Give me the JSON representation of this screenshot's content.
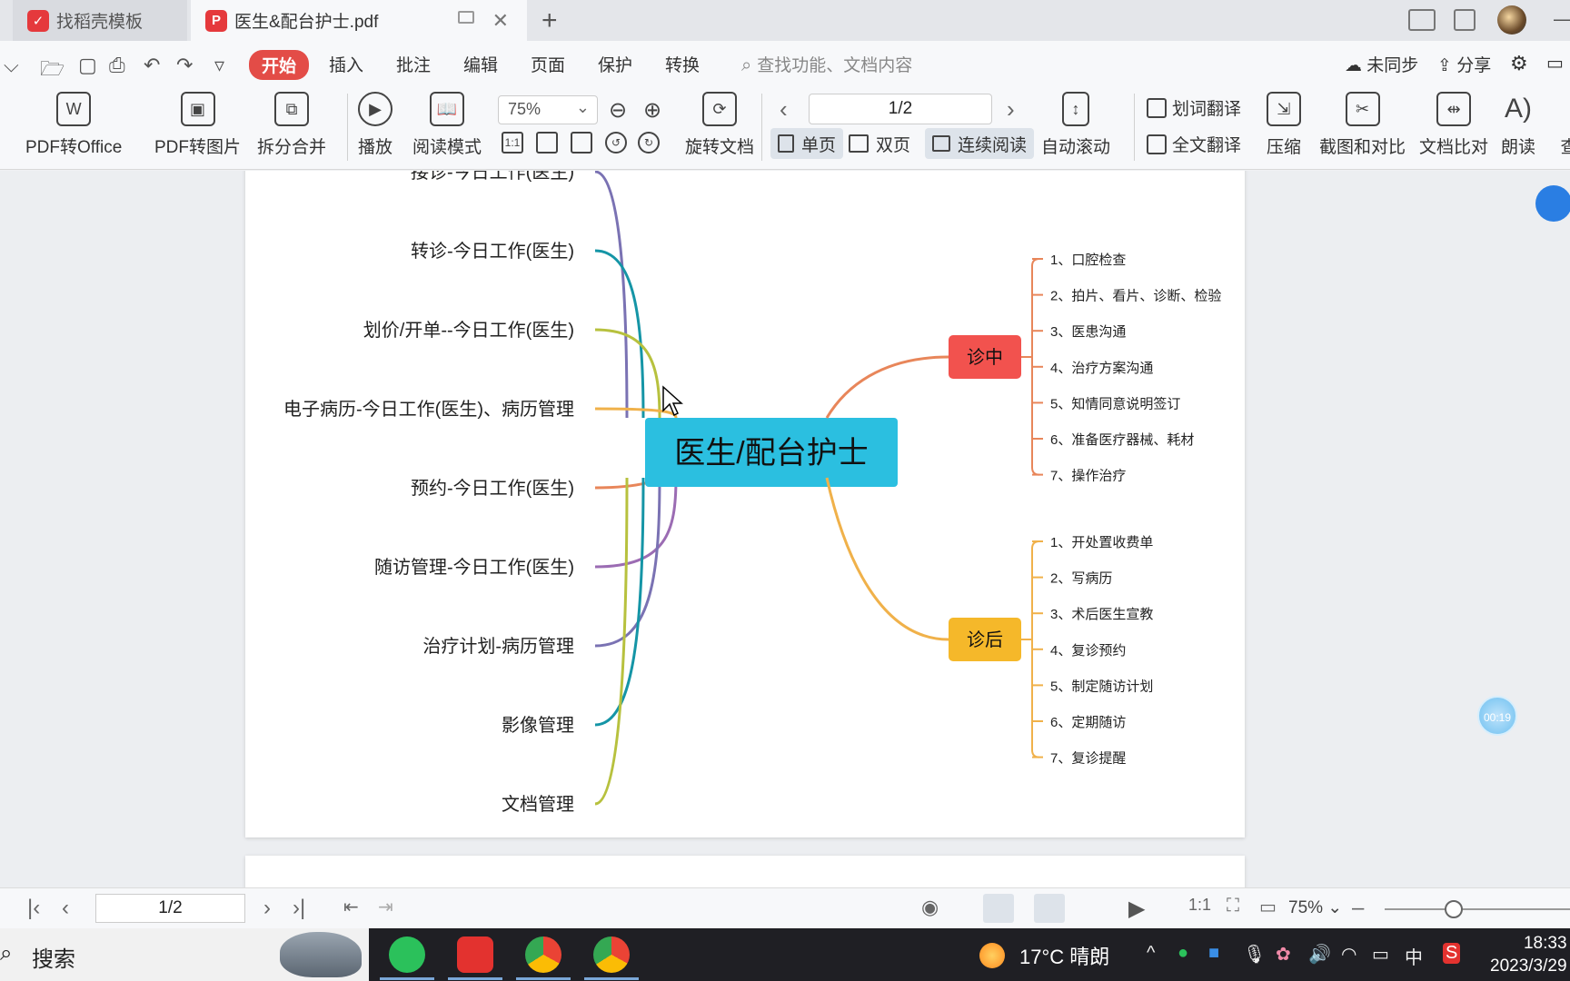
{
  "tabs": [
    {
      "label": "找稻壳模板"
    },
    {
      "label": "医生&配台护士.pdf"
    }
  ],
  "menu": {
    "items": [
      "开始",
      "插入",
      "批注",
      "编辑",
      "页面",
      "保护",
      "转换"
    ],
    "search_placeholder": "查找功能、文档内容",
    "sync": "未同步",
    "share": "分享"
  },
  "toolbar": {
    "pdf_to_office": "PDF转Office",
    "pdf_to_image": "PDF转图片",
    "split_merge": "拆分合并",
    "play": "播放",
    "read_mode": "阅读模式",
    "zoom": "75%",
    "rotate": "旋转文档",
    "page": "1/2",
    "single_page": "单页",
    "double_page": "双页",
    "continuous": "连续阅读",
    "auto_scroll": "自动滚动",
    "word_translate": "划词翻译",
    "full_translate": "全文翻译",
    "compress": "压缩",
    "screenshot_compare": "截图和对比",
    "doc_compare": "文档比对",
    "read_aloud": "朗读",
    "more": "查"
  },
  "mindmap": {
    "center": "医生/配台护士",
    "left_branches": [
      {
        "label": "接诊-今日工作(医生)",
        "color": "#7a72b3"
      },
      {
        "label": "转诊-今日工作(医生)",
        "color": "#1595a6"
      },
      {
        "label": "划价/开单--今日工作(医生)",
        "color": "#b7c13e"
      },
      {
        "label": "电子病历-今日工作(医生)、病历管理",
        "color": "#f0b14a"
      },
      {
        "label": "预约-今日工作(医生)",
        "color": "#e8865a"
      },
      {
        "label": "随访管理-今日工作(医生)",
        "color": "#9b6cb3"
      },
      {
        "label": "治疗计划-病历管理",
        "color": "#7a72b3"
      },
      {
        "label": "影像管理",
        "color": "#1595a6"
      },
      {
        "label": "文档管理",
        "color": "#b7c13e"
      }
    ],
    "right_nodes": [
      {
        "label": "诊中",
        "color": "#f2524e",
        "items": [
          "1、口腔检查",
          "2、拍片、看片、诊断、检验",
          "3、医患沟通",
          "4、治疗方案沟通",
          "5、知情同意说明签订",
          "6、准备医疗器械、耗材",
          "7、操作治疗"
        ]
      },
      {
        "label": "诊后",
        "color": "#f5b82a",
        "items": [
          "1、开处置收费单",
          "2、写病历",
          "3、术后医生宣教",
          "4、复诊预约",
          "5、制定随访计划",
          "6、定期随访",
          "7、复诊提醒"
        ]
      }
    ]
  },
  "timer": "00:19",
  "statusbar": {
    "page": "1/2",
    "zoom": "75%"
  },
  "taskbar": {
    "search": "搜索",
    "weather": "17°C  晴朗",
    "ime": "中",
    "time": "18:33",
    "date": "2023/3/29"
  }
}
